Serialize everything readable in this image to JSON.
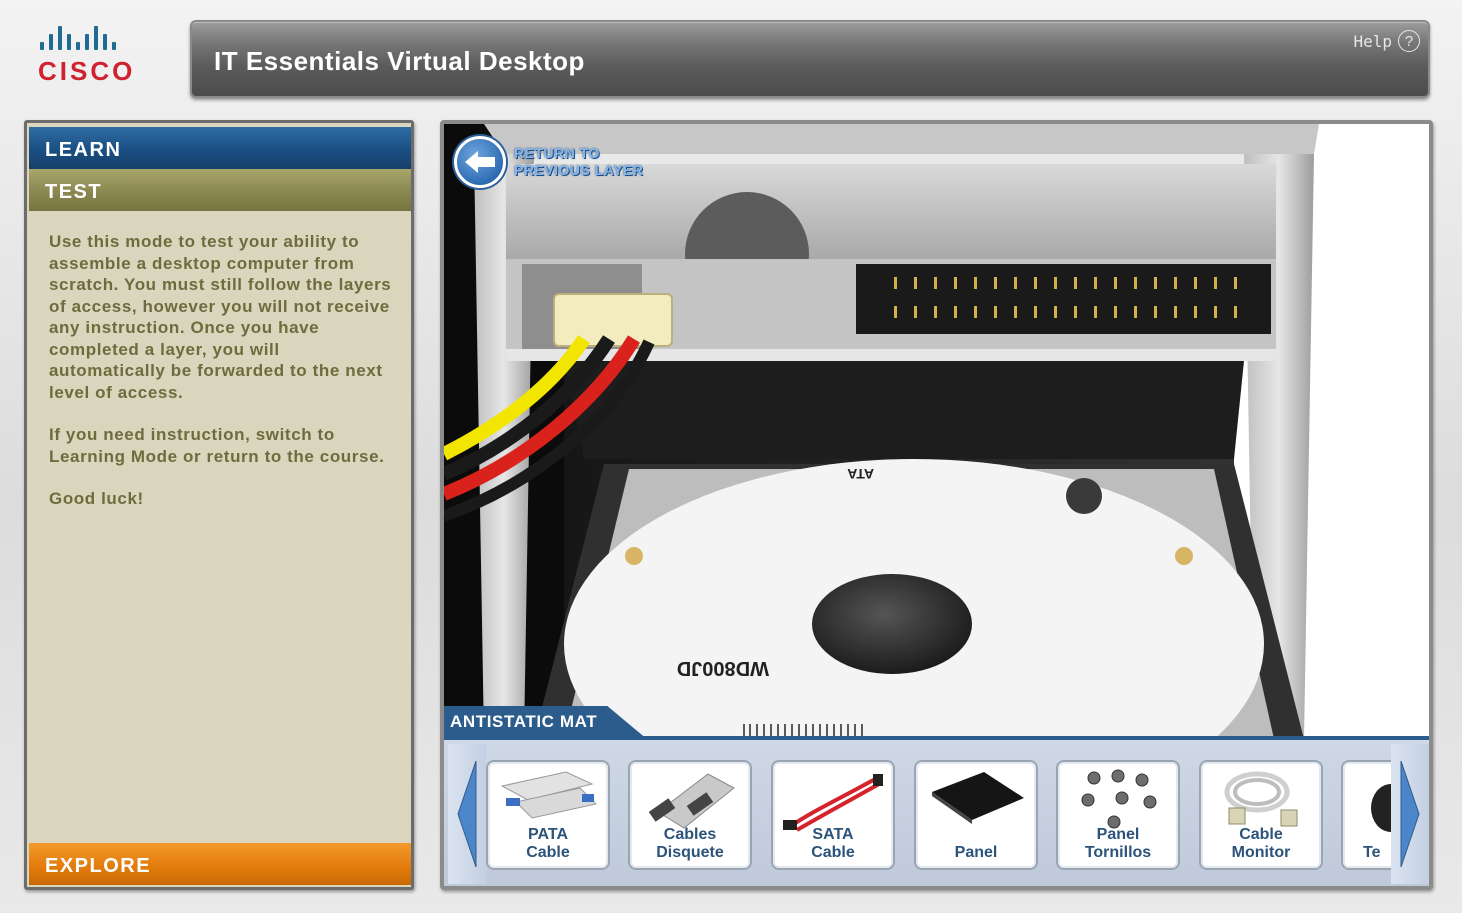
{
  "brand": {
    "name": "CISCO"
  },
  "header": {
    "title": "IT Essentials Virtual Desktop",
    "help_label": "Help",
    "help_symbol": "?"
  },
  "sidebar": {
    "tabs": [
      {
        "label": "LEARN",
        "color": "#1a4f82"
      },
      {
        "label": "TEST",
        "color": "#8a8751"
      },
      {
        "label": "EXPLORE",
        "color": "#e17a0b"
      }
    ],
    "paragraphs": [
      "Use this mode to test your ability to assemble a desktop computer from scratch. You must still follow the layers of access, however you will not receive any instruction. Once you have completed a layer, you will automatically be forwarded to the next level of access.",
      "If you need instruction, switch to Learning Mode or return to the course.",
      "Good luck!"
    ]
  },
  "viewport": {
    "return_button": {
      "line1": "RETURN TO",
      "line2": "PREVIOUS LAYER"
    },
    "scene_labels": {
      "hdd_model": "WD800JD",
      "ata": "ATA"
    }
  },
  "tray": {
    "title": "ANTISTATIC MAT",
    "items": [
      {
        "line1": "PATA",
        "line2": "Cable",
        "icon": "pata-cable-icon"
      },
      {
        "line1": "Cables",
        "line2": "Disquete",
        "icon": "floppy-cable-icon"
      },
      {
        "line1": "SATA",
        "line2": "Cable",
        "icon": "sata-cable-icon"
      },
      {
        "line1": "",
        "line2": "Panel",
        "icon": "panel-icon"
      },
      {
        "line1": "Panel",
        "line2": "Tornillos",
        "icon": "screws-icon"
      },
      {
        "line1": "Cable",
        "line2": "Monitor",
        "icon": "monitor-cable-icon"
      },
      {
        "line1": "",
        "line2": "Te",
        "icon": "keyboard-icon"
      }
    ]
  },
  "colors": {
    "accent_blue": "#2c5c8c",
    "cisco_red": "#d1202f",
    "text_olive": "#6e6c3d"
  }
}
